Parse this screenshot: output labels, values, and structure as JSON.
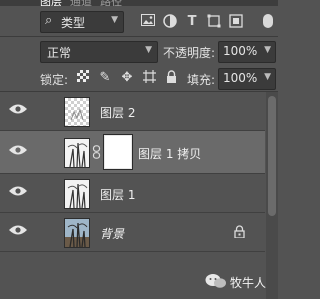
{
  "tabs": [
    {
      "label": "图层",
      "active": true
    },
    {
      "label": "通道",
      "active": false
    },
    {
      "label": "路径",
      "active": false
    }
  ],
  "filter": {
    "kind_label": "类型",
    "icons": [
      "image-filter-icon",
      "adjustment-filter-icon",
      "type-filter-icon",
      "shape-filter-icon",
      "smart-object-filter-icon"
    ]
  },
  "blend": {
    "mode": "正常",
    "opacity_label": "不透明度:",
    "opacity_value": "100%"
  },
  "lock": {
    "label": "锁定:",
    "icons": [
      "lock-transparent-pixels-icon",
      "lock-image-pixels-icon",
      "lock-position-icon",
      "lock-artboard-icon",
      "lock-all-icon"
    ],
    "fill_label": "填充:",
    "fill_value": "100%"
  },
  "layers": [
    {
      "name": "图层 2",
      "visible": true,
      "selected": false,
      "has_mask": false,
      "locked": false
    },
    {
      "name": "图层 1 拷贝",
      "visible": true,
      "selected": true,
      "has_mask": true,
      "locked": false
    },
    {
      "name": "图层 1",
      "visible": true,
      "selected": false,
      "has_mask": false,
      "locked": false
    },
    {
      "name": "背景",
      "visible": true,
      "selected": false,
      "has_mask": false,
      "locked": true
    }
  ],
  "watermark": {
    "text": "牧牛人"
  },
  "colors": {
    "panel_bg": "#535353",
    "selected_row": "#6a6a6a",
    "field_bg": "#3b3b3b"
  }
}
